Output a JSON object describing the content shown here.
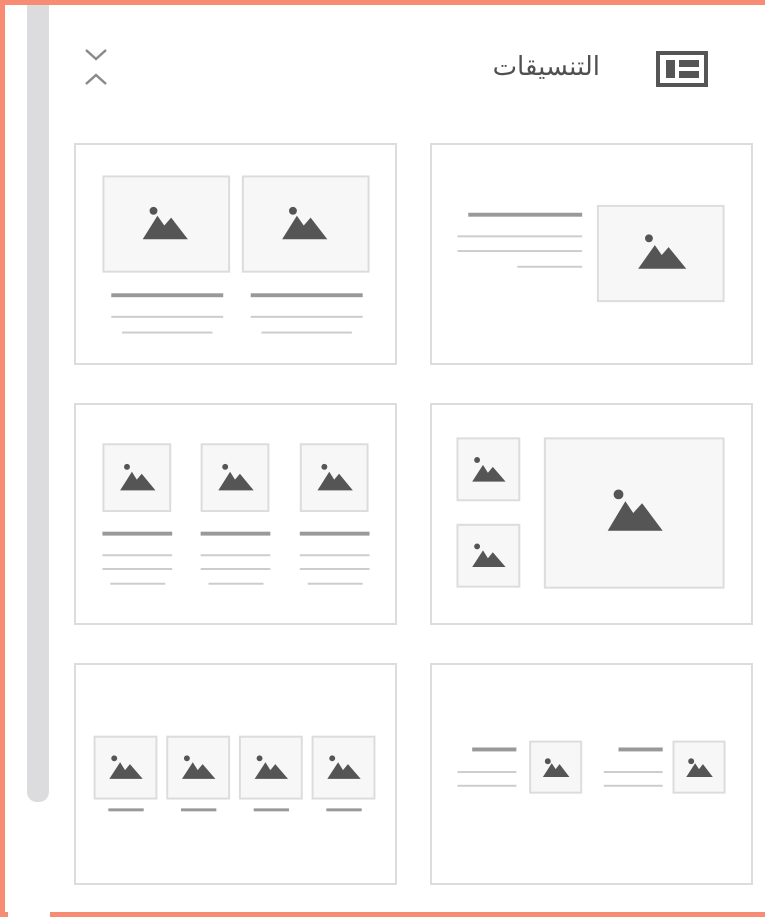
{
  "panel": {
    "title": "التنسيقات",
    "title_icon": "layout-icon",
    "collapse_icon": "collapse-icon",
    "accent_border": "#f58c73"
  },
  "layouts": [
    {
      "name": "layout-two-images-with-captions"
    },
    {
      "name": "layout-text-left-image-right"
    },
    {
      "name": "layout-three-columns"
    },
    {
      "name": "layout-two-small-one-large"
    },
    {
      "name": "layout-four-images-row"
    },
    {
      "name": "layout-two-text-image-pairs"
    }
  ]
}
